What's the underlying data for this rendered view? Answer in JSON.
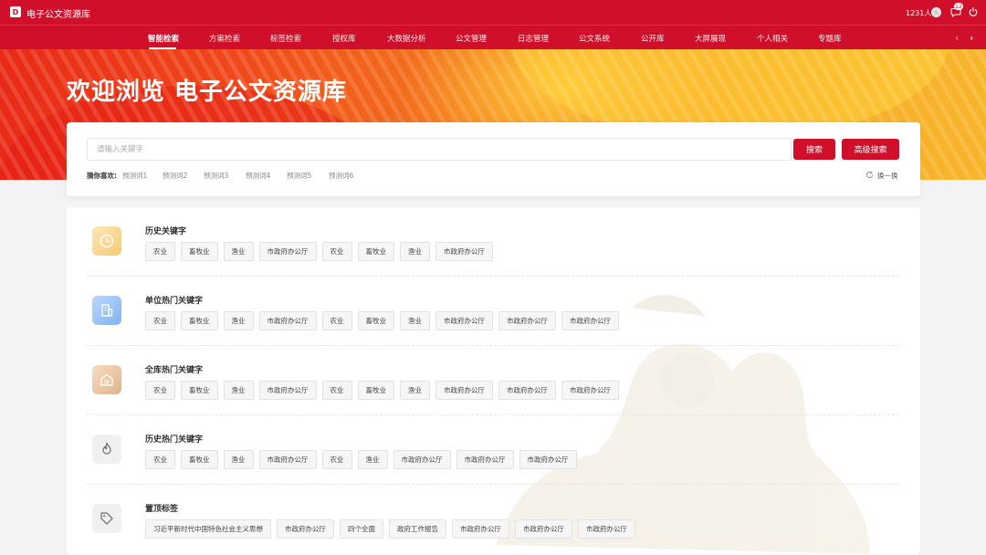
{
  "app": {
    "title": "电子公文资源库",
    "logo_text": "D"
  },
  "topbar": {
    "user_count": "1231人",
    "avatar_text": "头",
    "message_badge": "12"
  },
  "nav": {
    "items": [
      "智能检索",
      "方案检索",
      "标签检索",
      "授权库",
      "大数据分析",
      "公文管理",
      "日志管理",
      "公文系统",
      "公开库",
      "大屏展现",
      "个人相关",
      "专题库"
    ],
    "active": "智能检索",
    "prev": "‹",
    "next": "›"
  },
  "banner": {
    "title": "欢迎浏览 电子公文资源库"
  },
  "search": {
    "placeholder": "请输入关键字",
    "value": "",
    "search_label": "搜索",
    "advanced_label": "高级搜索",
    "guess_label": "猜你喜欢:",
    "suggestions": [
      "预测词1",
      "预测词2",
      "预测词3",
      "预测词4",
      "预测词5",
      "预测词6"
    ],
    "refresh_label": "换一换"
  },
  "sections": [
    {
      "title": "历史关键字",
      "icon": "clock-icon",
      "tags": [
        "农业",
        "畜牧业",
        "渔业",
        "市政府办公厅",
        "农业",
        "畜牧业",
        "渔业",
        "市政府办公厅"
      ]
    },
    {
      "title": "单位热门关键字",
      "icon": "building-icon",
      "tags": [
        "农业",
        "畜牧业",
        "渔业",
        "市政府办公厅",
        "农业",
        "畜牧业",
        "渔业",
        "市政府办公厅",
        "市政府办公厅",
        "市政府办公厅"
      ]
    },
    {
      "title": "全库热门关键字",
      "icon": "library-icon",
      "tags": [
        "农业",
        "畜牧业",
        "渔业",
        "市政府办公厅",
        "农业",
        "畜牧业",
        "渔业",
        "市政府办公厅",
        "市政府办公厅",
        "市政府办公厅"
      ]
    },
    {
      "title": "历史热门关键字",
      "icon": "flame-icon",
      "tags": [
        "农业",
        "畜牧业",
        "渔业",
        "市政府办公厅",
        "农业",
        "渔业",
        "市政府办公厅",
        "市政府办公厅",
        "市政府办公厅"
      ]
    },
    {
      "title": "置顶标签",
      "icon": "tag-icon",
      "tags": [
        "习近平新时代中国特色社会主义思想",
        "市政府办公厅",
        "四个全面",
        "政府工作报告",
        "市政府办公厅",
        "市政府办公厅",
        "市政府办公厅"
      ]
    }
  ],
  "colors": {
    "brand": "#d0102a"
  }
}
